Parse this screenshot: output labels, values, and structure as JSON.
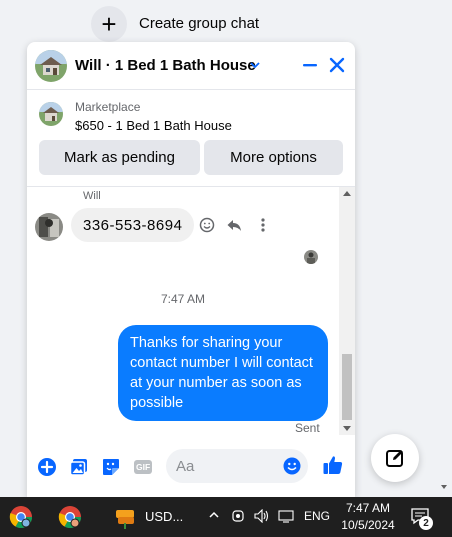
{
  "top": {
    "create_group_label": "Create group chat"
  },
  "header": {
    "title": "Will · 1 Bed 1 Bath House"
  },
  "marketplace": {
    "label": "Marketplace",
    "listing": "$650 - 1 Bed 1 Bath House",
    "pending_button": "Mark as pending",
    "more_button": "More options"
  },
  "thread": {
    "sender": "Will",
    "incoming_message": "336-553-8694",
    "timestamp": "7:47 AM",
    "outgoing_message": "Thanks for sharing your contact number I will contact at your number as soon as possible",
    "status": "Sent"
  },
  "composer": {
    "placeholder": "Aa",
    "gif_label": "GIF"
  },
  "taskbar": {
    "app_label": "USD...",
    "language": "ENG",
    "time": "7:47 AM",
    "date": "10/5/2024",
    "notification_count": "2"
  },
  "colors": {
    "messenger_blue": "#0a7cff",
    "accent": "#0866ff"
  }
}
